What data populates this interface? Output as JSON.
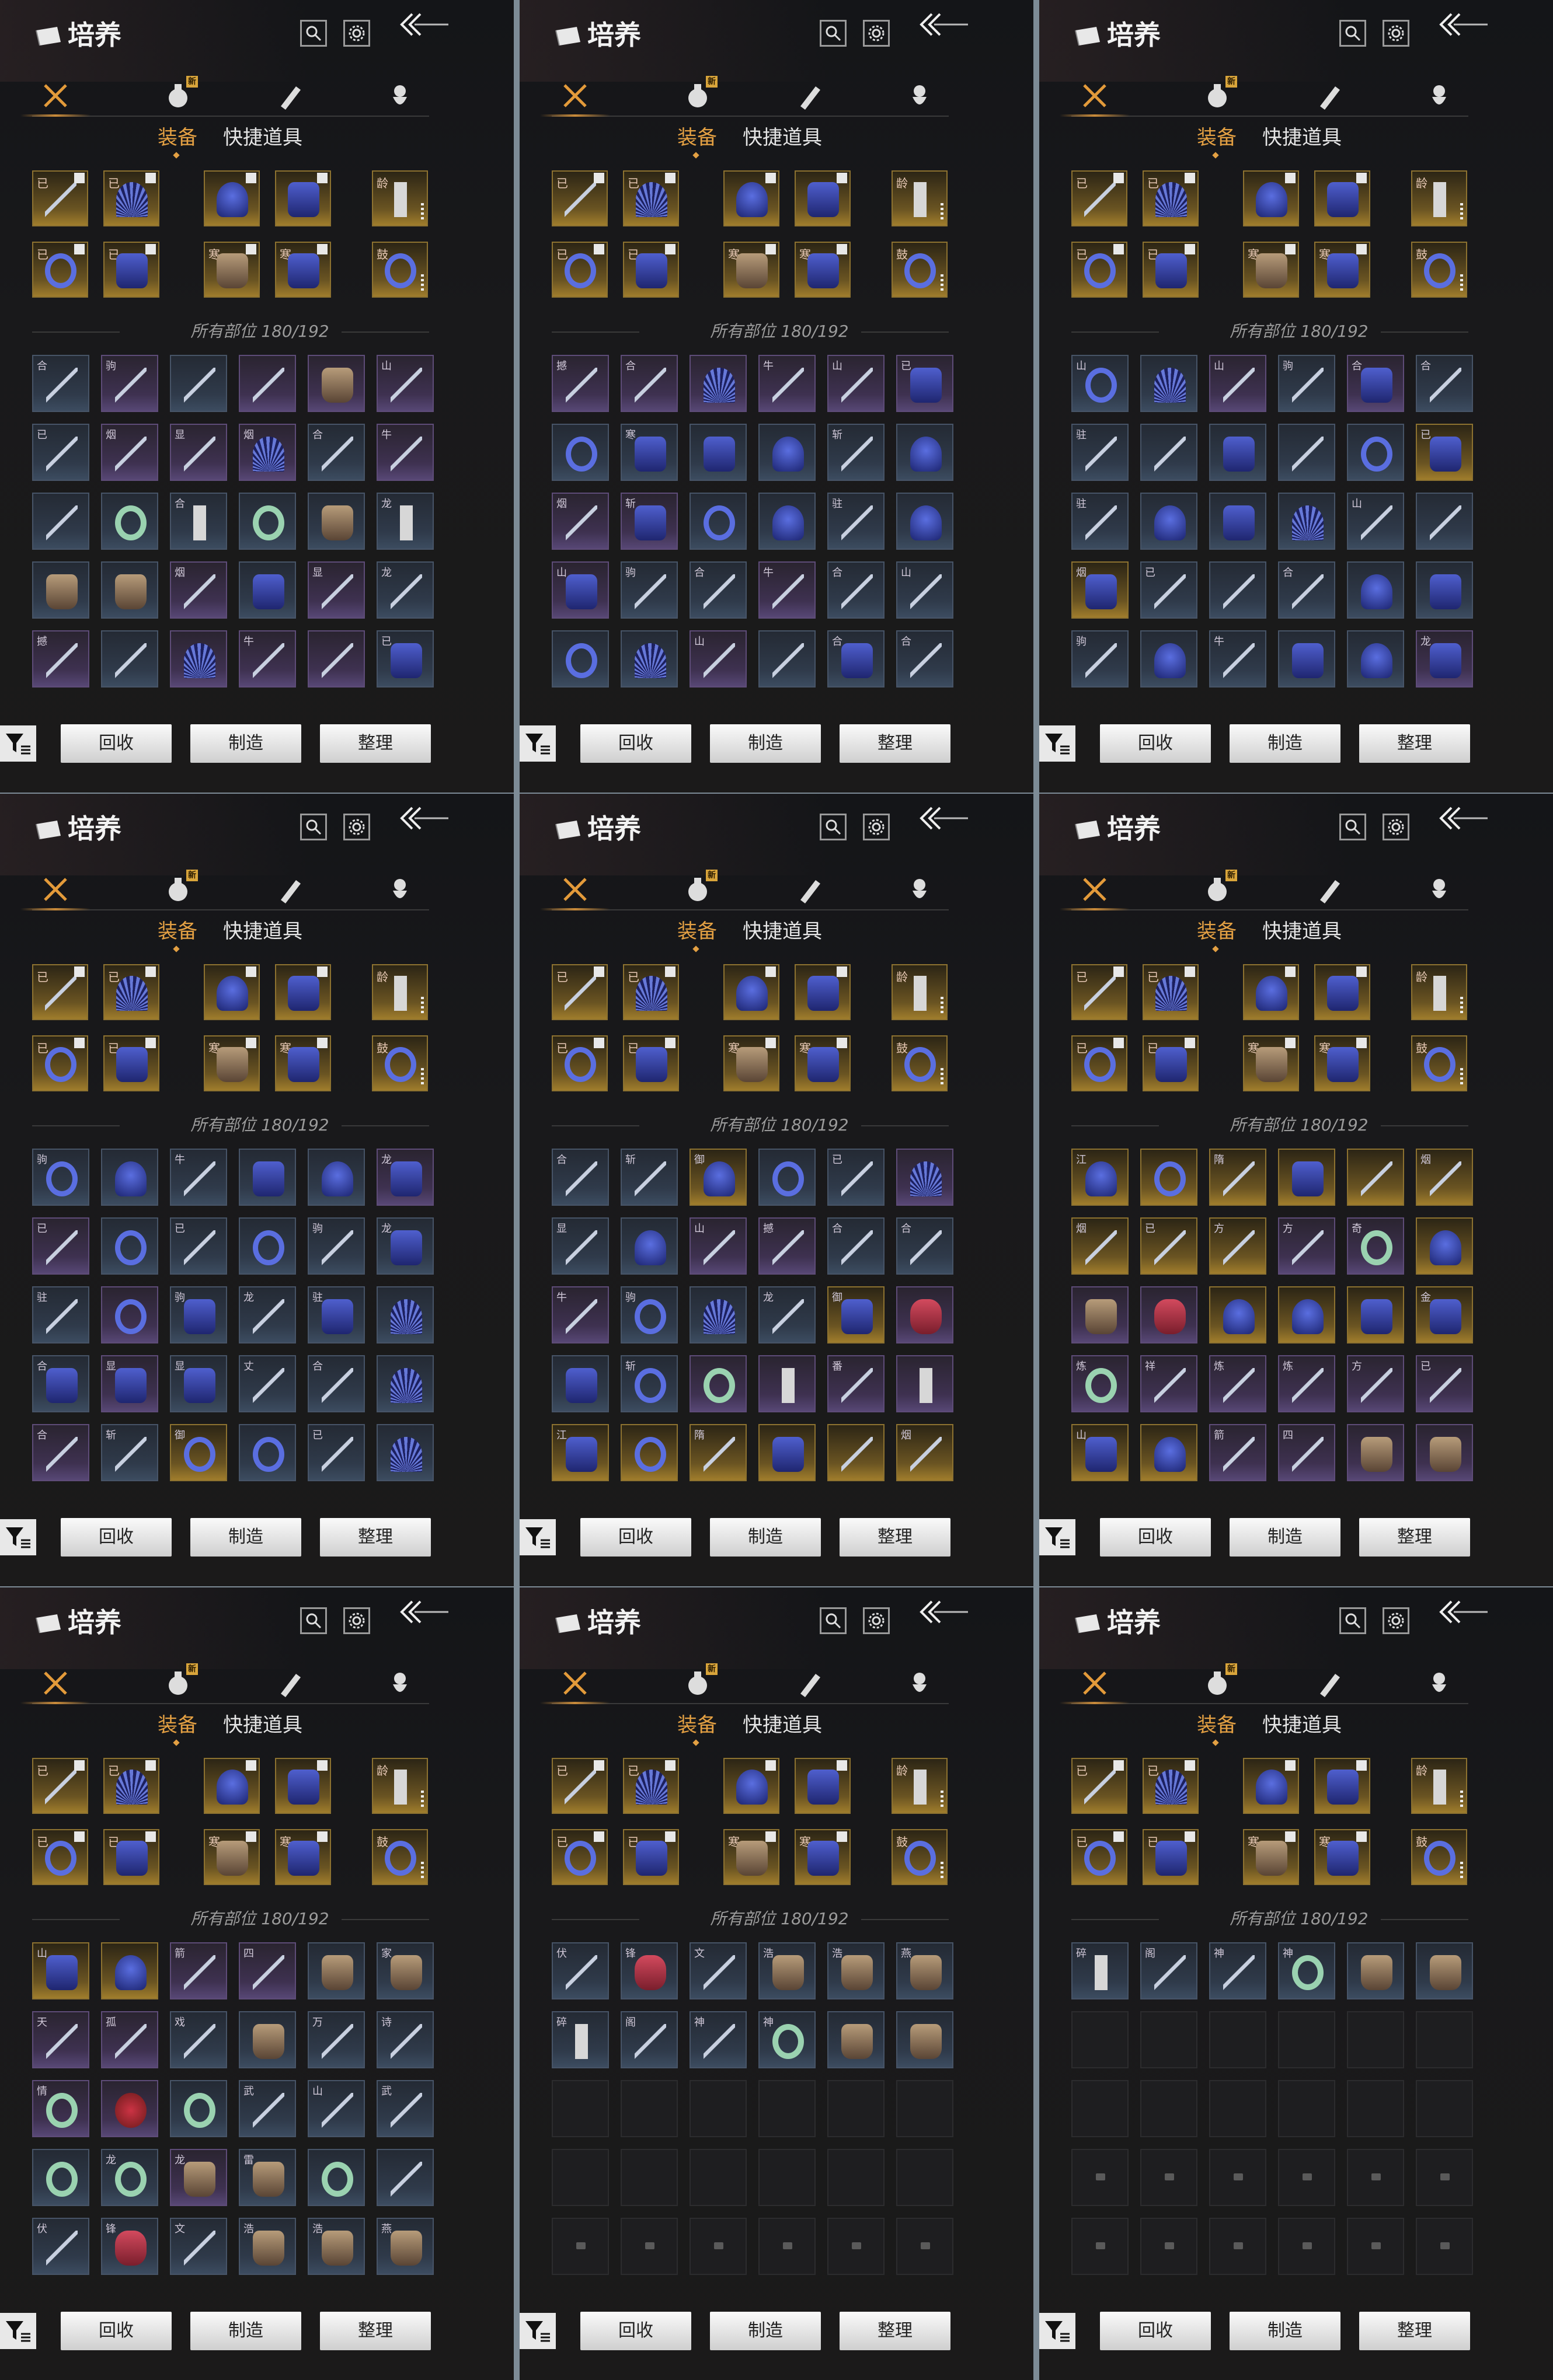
{
  "panel": {
    "title": "培养",
    "new_tag": "新",
    "sub_tabs": [
      "装备",
      "快捷道具"
    ],
    "slots_caption": "所有部位 180/192",
    "buttons": [
      "回收",
      "制造",
      "整理"
    ],
    "icons": [
      "search-icon",
      "settings-gear-icon",
      "back-arrow-icon",
      "filter-icon",
      "tab-weapon-icon",
      "tab-bag-icon",
      "tab-scroll-icon",
      "tab-spirit-icon"
    ]
  },
  "equipped_slots": [
    {
      "label": "已",
      "kind": "sword"
    },
    {
      "label": "已",
      "kind": "fan"
    },
    {
      "label": "",
      "kind": "helm"
    },
    {
      "label": "",
      "kind": "gaunt"
    },
    {
      "label": "龄",
      "kind": "scroll"
    },
    {
      "label": "已",
      "kind": "ring"
    },
    {
      "label": "已",
      "kind": "gaunt"
    },
    {
      "label": "寒",
      "kind": "armor"
    },
    {
      "label": "寒",
      "kind": "gaunt"
    },
    {
      "label": "鼓",
      "kind": "ring"
    }
  ],
  "panels": [
    {
      "rows": [
        [
          "c-blue:sword:合",
          "c-purple:sword:驹",
          "c-blue:sword:",
          "c-purple:sword:",
          "c-purple:armor:",
          "c-purple:sword:山"
        ],
        [
          "c-blue:sword:已",
          "c-purple:sword:烟",
          "c-purple:sword:显",
          "c-purple:fan:烟",
          "c-blue:sword:合",
          "c-purple:sword:牛"
        ],
        [
          "c-blue:sword:",
          "c-blue:jade:",
          "c-blue:scroll:合",
          "c-blue:jade:",
          "c-blue:armor:",
          "c-blue:scroll:龙"
        ],
        [
          "c-blue:armor:",
          "c-blue:armor:",
          "c-purple:sword:烟",
          "c-blue:gaunt:",
          "c-purple:sword:显",
          "c-blue:sword:龙"
        ],
        [
          "c-purple:sword:撼",
          "c-blue:sword:",
          "c-purple:fan:",
          "c-purple:sword:牛",
          "c-purple:sword:",
          "c-blue:gaunt:已"
        ]
      ]
    },
    {
      "rows": [
        [
          "c-purple:sword:撼",
          "c-purple:sword:合",
          "c-purple:fan:",
          "c-purple:sword:牛",
          "c-purple:sword:山",
          "c-purple:gaunt:已"
        ],
        [
          "c-blue:ring:",
          "c-blue:gaunt:寒",
          "c-blue:gaunt:",
          "c-blue:helm:",
          "c-blue:sword:斩",
          "c-blue:helm:"
        ],
        [
          "c-purple:sword:烟",
          "c-purple:gaunt:斩",
          "c-blue:ring:",
          "c-blue:helm:",
          "c-blue:sword:驻",
          "c-blue:helm:"
        ],
        [
          "c-purple:gaunt:山",
          "c-blue:sword:驹",
          "c-blue:sword:合",
          "c-purple:sword:牛",
          "c-blue:sword:合",
          "c-blue:sword:山"
        ],
        [
          "c-blue:ring:",
          "c-blue:fan:",
          "c-purple:sword:山",
          "c-blue:sword:",
          "c-blue:gaunt:合",
          "c-blue:sword:合"
        ]
      ]
    },
    {
      "rows": [
        [
          "c-blue:ring:山",
          "c-blue:fan:",
          "c-purple:sword:山",
          "c-blue:sword:驹",
          "c-purple:gaunt:合",
          "c-blue:sword:合"
        ],
        [
          "c-blue:sword:驻",
          "c-blue:sword:",
          "c-blue:gaunt:",
          "c-blue:sword:",
          "c-blue:ring:",
          "c-gold:gaunt:已"
        ],
        [
          "c-blue:sword:驻",
          "c-blue:helm:",
          "c-blue:gaunt:",
          "c-blue:fan:",
          "c-blue:sword:山",
          "c-blue:sword:"
        ],
        [
          "c-gold:gaunt:烟",
          "c-blue:sword:已",
          "c-blue:sword:",
          "c-blue:sword:合",
          "c-blue:helm:",
          "c-blue:gaunt:"
        ],
        [
          "c-blue:sword:驹",
          "c-blue:helm:",
          "c-blue:sword:牛",
          "c-blue:gaunt:",
          "c-blue:helm:",
          "c-purple:gaunt:龙"
        ]
      ]
    },
    {
      "rows": [
        [
          "c-blue:ring:驹",
          "c-blue:helm:",
          "c-blue:sword:牛",
          "c-blue:gaunt:",
          "c-blue:helm:",
          "c-purple:gaunt:龙"
        ],
        [
          "c-purple:sword:已",
          "c-blue:ring:",
          "c-blue:sword:已",
          "c-blue:ring:",
          "c-blue:sword:驹",
          "c-blue:gaunt:龙"
        ],
        [
          "c-blue:sword:驻",
          "c-purple:ring:",
          "c-blue:gaunt:驹",
          "c-blue:sword:龙",
          "c-blue:gaunt:驻",
          "c-blue:fan:"
        ],
        [
          "c-blue:gaunt:合",
          "c-purple:gaunt:显",
          "c-blue:gaunt:显",
          "c-blue:sword:丈",
          "c-blue:sword:合",
          "c-blue:fan:"
        ],
        [
          "c-purple:sword:合",
          "c-blue:sword:斩",
          "c-gold:ring:御",
          "c-blue:ring:",
          "c-blue:sword:已",
          "c-blue:fan:"
        ]
      ]
    },
    {
      "rows": [
        [
          "c-blue:sword:合",
          "c-blue:sword:斩",
          "c-gold:helm:御",
          "c-blue:ring:",
          "c-blue:sword:已",
          "c-purple:fan:"
        ],
        [
          "c-blue:sword:显",
          "c-blue:helm:",
          "c-purple:sword:山",
          "c-purple:sword:撼",
          "c-blue:sword:合",
          "c-blue:sword:合"
        ],
        [
          "c-purple:sword:牛",
          "c-blue:ring:驹",
          "c-blue:fan:",
          "c-blue:sword:龙",
          "c-gold:gaunt:御",
          "c-purple:tassel:"
        ],
        [
          "c-blue:gaunt:",
          "c-blue:ring:斩",
          "c-purple:jade:",
          "c-purple:scroll:",
          "c-purple:sword:番",
          "c-purple:scroll:"
        ],
        [
          "c-gold:gaunt:江",
          "c-gold:ring:",
          "c-gold:sword:隋",
          "c-gold:gaunt:",
          "c-gold:sword:",
          "c-gold:sword:烟"
        ]
      ]
    },
    {
      "rows": [
        [
          "c-gold:helm:江",
          "c-gold:ring:",
          "c-gold:sword:隋",
          "c-gold:gaunt:",
          "c-gold:sword:",
          "c-gold:sword:烟"
        ],
        [
          "c-gold:sword:烟",
          "c-gold:sword:已",
          "c-gold:sword:方",
          "c-purple:sword:方",
          "c-purple:jade:奇",
          "c-gold:helm:"
        ],
        [
          "c-purple:armor:",
          "c-purple:tassel:",
          "c-gold:helm:",
          "c-gold:helm:",
          "c-gold:gaunt:",
          "c-gold:gaunt:金"
        ],
        [
          "c-purple:jade:炼",
          "c-purple:sword:祥",
          "c-purple:sword:炼",
          "c-purple:sword:炼",
          "c-purple:sword:方",
          "c-purple:sword:已"
        ],
        [
          "c-gold:gaunt:山",
          "c-gold:helm:",
          "c-purple:sword:箭",
          "c-purple:sword:四",
          "c-purple:armor:",
          "c-purple:armor:"
        ]
      ]
    },
    {
      "rows": [
        [
          "c-gold:gaunt:山",
          "c-gold:helm:",
          "c-purple:sword:箭",
          "c-purple:sword:四",
          "c-blue:armor:",
          "c-blue:armor:家"
        ],
        [
          "c-purple:sword:天",
          "c-purple:sword:孤",
          "c-blue:sword:戏",
          "c-blue:armor:",
          "c-blue:sword:万",
          "c-blue:sword:诗"
        ],
        [
          "c-purple:jade:情",
          "c-purple:gem:",
          "c-blue:jade:",
          "c-blue:sword:武",
          "c-blue:sword:山",
          "c-blue:sword:武"
        ],
        [
          "c-blue:jade:",
          "c-blue:jade:龙",
          "c-purple:armor:龙",
          "c-blue:armor:雷",
          "c-blue:jade:",
          "c-blue:sword:"
        ],
        [
          "c-blue:sword:伏",
          "c-blue:tassel:锋",
          "c-blue:sword:文",
          "c-blue:armor:浩",
          "c-blue:armor:浩",
          "c-blue:armor:燕"
        ]
      ]
    },
    {
      "rows": [
        [
          "c-blue:sword:伏",
          "c-blue:tassel:锋",
          "c-blue:sword:文",
          "c-blue:armor:浩",
          "c-blue:armor:浩",
          "c-blue:armor:燕"
        ],
        [
          "c-blue:scroll:碎",
          "c-blue:sword:阁",
          "c-blue:sword:神",
          "c-blue:jade:神",
          "c-blue:armor:",
          "c-blue:armor:"
        ],
        [
          "c-empty::",
          "c-empty::",
          "c-empty::",
          "c-empty::",
          "c-empty::",
          "c-empty::"
        ],
        [
          "c-empty::",
          "c-empty::",
          "c-empty::",
          "c-empty::",
          "c-empty::",
          "c-empty::"
        ],
        [
          "c-locked::",
          "c-locked::",
          "c-locked::",
          "c-locked::",
          "c-locked::",
          "c-locked::"
        ]
      ]
    },
    {
      "rows": [
        [
          "c-blue:scroll:碎",
          "c-blue:sword:阁",
          "c-blue:sword:神",
          "c-blue:jade:神",
          "c-blue:armor:",
          "c-blue:armor:"
        ],
        [
          "c-empty::",
          "c-empty::",
          "c-empty::",
          "c-empty::",
          "c-empty::",
          "c-empty::"
        ],
        [
          "c-empty::",
          "c-empty::",
          "c-empty::",
          "c-empty::",
          "c-empty::",
          "c-empty::"
        ],
        [
          "c-locked::",
          "c-locked::",
          "c-locked::",
          "c-locked::",
          "c-locked::",
          "c-locked::"
        ],
        [
          "c-locked::",
          "c-locked::",
          "c-locked::",
          "c-locked::",
          "c-locked::",
          "c-locked::"
        ]
      ]
    }
  ]
}
